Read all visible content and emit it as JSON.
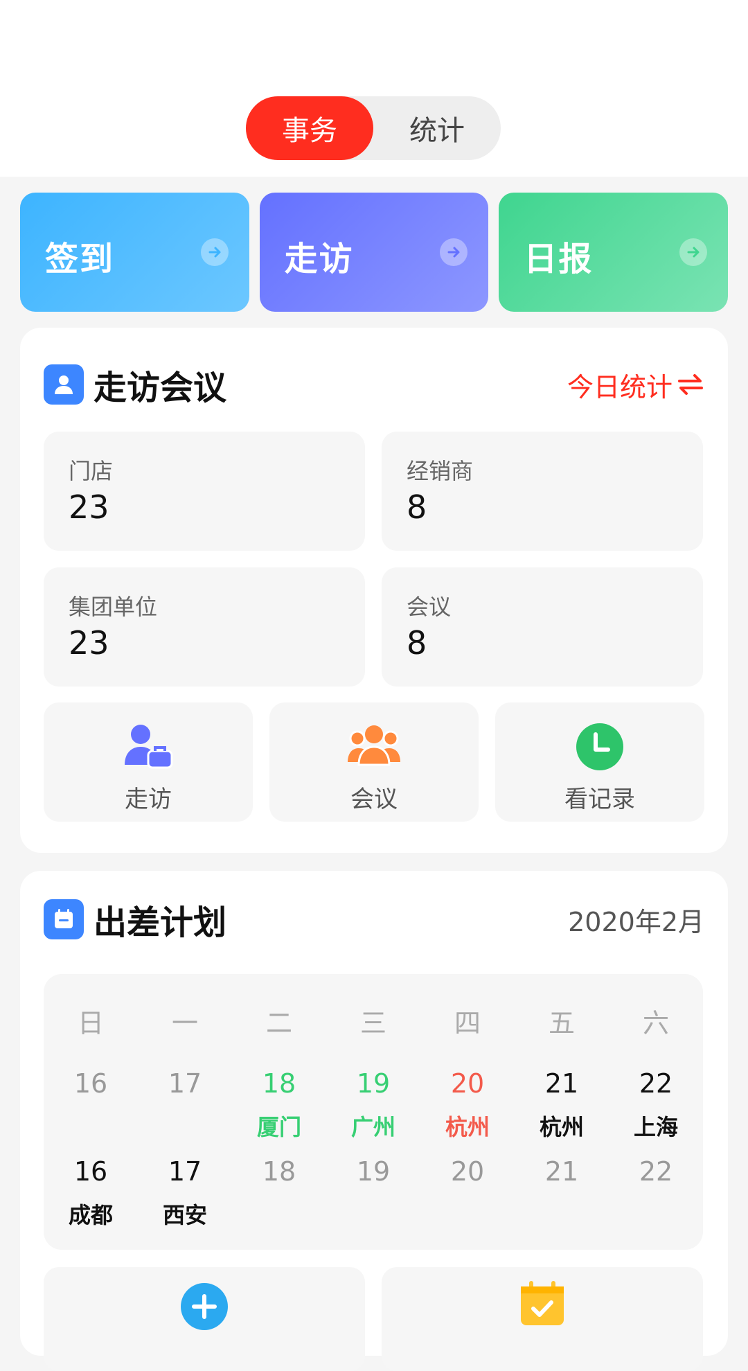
{
  "tabs": {
    "affairs": "事务",
    "stats": "统计"
  },
  "quick_actions": [
    {
      "label": "签到",
      "color": "#3db4ff"
    },
    {
      "label": "走访",
      "color": "#6471ff"
    },
    {
      "label": "日报",
      "color": "#3fd58f"
    }
  ],
  "visit_meeting": {
    "title": "走访会议",
    "right_link": "今日统计",
    "stats": [
      {
        "label": "门店",
        "value": "23"
      },
      {
        "label": "经销商",
        "value": "8"
      },
      {
        "label": "集团单位",
        "value": "23"
      },
      {
        "label": "会议",
        "value": "8"
      }
    ],
    "actions": [
      {
        "label": "走访",
        "icon": "visitor-icon"
      },
      {
        "label": "会议",
        "icon": "group-icon"
      },
      {
        "label": "看记录",
        "icon": "clock-icon"
      }
    ]
  },
  "trip_plan": {
    "title": "出差计划",
    "month": "2020年2月",
    "weekdays": [
      "日",
      "一",
      "二",
      "三",
      "四",
      "五",
      "六"
    ],
    "rows": [
      [
        {
          "day": "16",
          "city": ""
        },
        {
          "day": "17",
          "city": ""
        },
        {
          "day": "18",
          "city": "厦门"
        },
        {
          "day": "19",
          "city": "广州"
        },
        {
          "day": "20",
          "city": "杭州"
        },
        {
          "day": "21",
          "city": "杭州"
        },
        {
          "day": "22",
          "city": "上海"
        }
      ],
      [
        {
          "day": "16",
          "city": "成都"
        },
        {
          "day": "17",
          "city": "西安"
        },
        {
          "day": "18",
          "city": ""
        },
        {
          "day": "19",
          "city": ""
        },
        {
          "day": "20",
          "city": ""
        },
        {
          "day": "21",
          "city": ""
        },
        {
          "day": "22",
          "city": ""
        }
      ]
    ]
  },
  "colors": {
    "accent_red": "#ff2d1f",
    "blue": "#3d86ff",
    "green": "#37cf73",
    "orange": "#ff8a3d",
    "yellow": "#ffc42e"
  }
}
